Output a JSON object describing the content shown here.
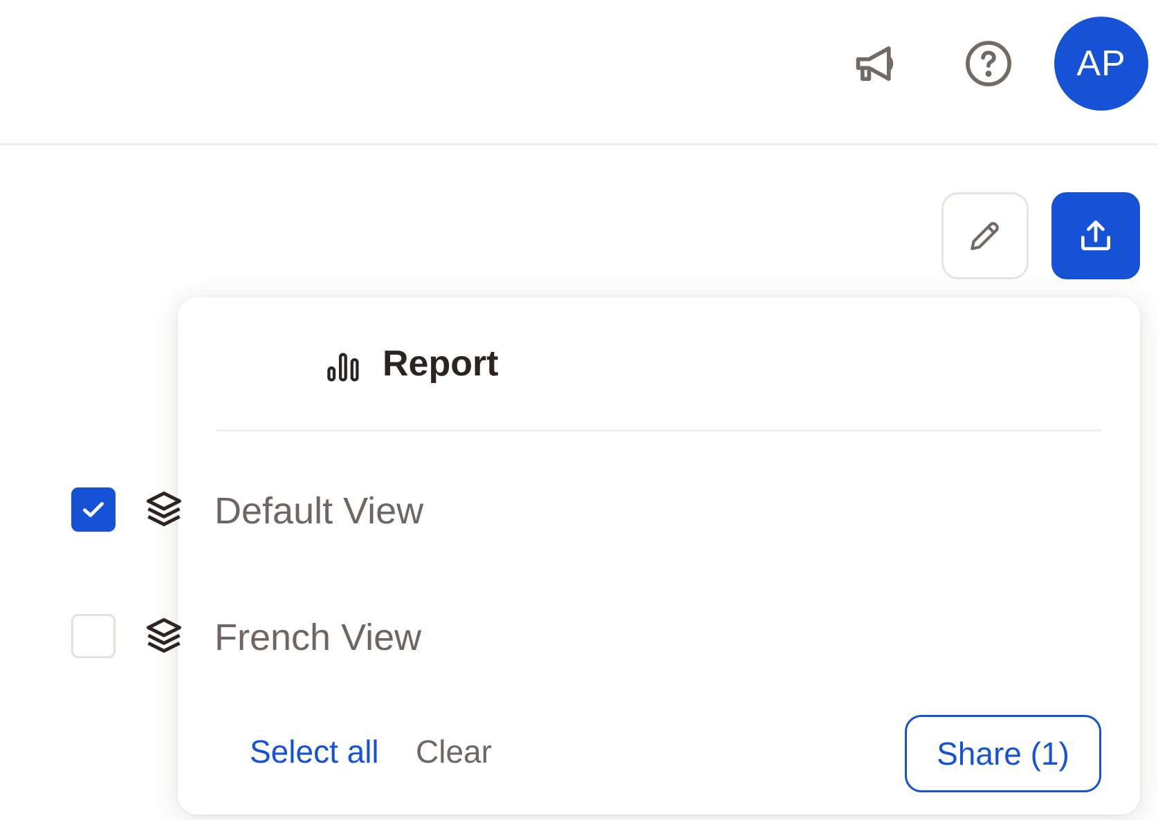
{
  "header": {
    "avatar_initials": "AP",
    "icons": [
      "megaphone-icon",
      "help-circle-icon"
    ]
  },
  "toolbar": {
    "icons": [
      "pencil-icon",
      "upload-share-icon"
    ]
  },
  "share_popover": {
    "title": "Report",
    "title_icon": "bar-chart-icon",
    "views": [
      {
        "label": "Default View",
        "checked": true,
        "icon": "layers-icon"
      },
      {
        "label": "French View",
        "checked": false,
        "icon": "layers-icon"
      }
    ],
    "select_all_label": "Select all",
    "clear_label": "Clear",
    "share_button_label": "Share (1)"
  },
  "colors": {
    "accent": "#1652d6",
    "text_muted": "#6e6663",
    "text_dark": "#2b2422",
    "divider": "#f3ece8"
  }
}
